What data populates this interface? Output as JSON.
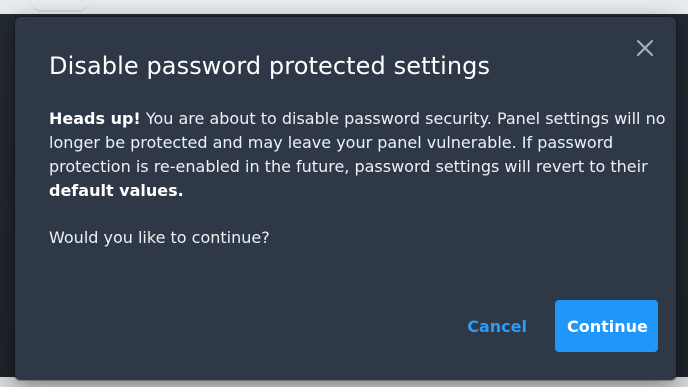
{
  "dialog": {
    "title": "Disable password protected settings",
    "close_icon": "close-icon",
    "body": {
      "heads_up": "Heads up!",
      "message_part1": " You are about to disable password security. Panel settings will no longer be protected and may leave your panel vulnerable. If password protection is re-enabled in the future, password settings will revert to their ",
      "message_bold_end": "default values.",
      "question": "Would you like to continue?"
    },
    "buttons": {
      "cancel_label": "Cancel",
      "continue_label": "Continue"
    }
  },
  "colors": {
    "dialog_background": "#2e3846",
    "accent": "#1f96fa",
    "text": "#eef1f5"
  }
}
